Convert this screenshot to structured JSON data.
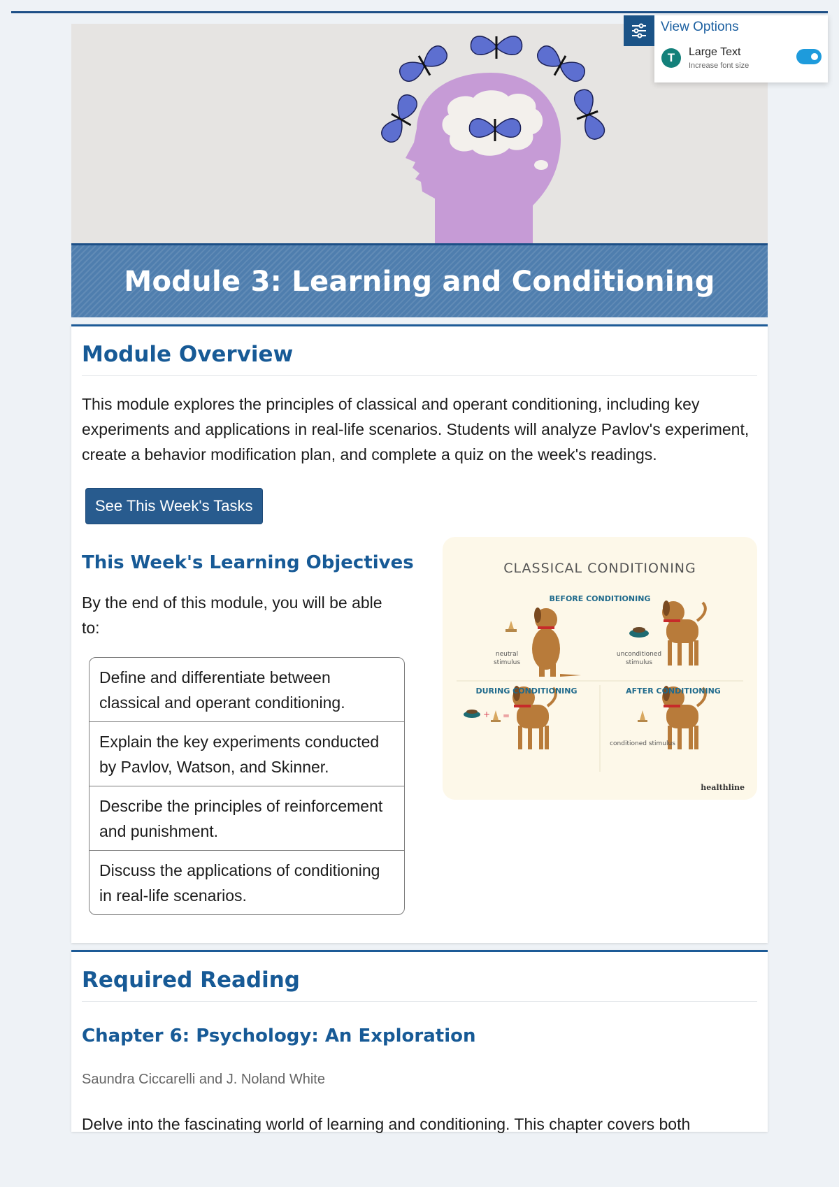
{
  "module": {
    "title": "Module 3: Learning and Conditioning"
  },
  "overview": {
    "heading": "Module Overview",
    "text": "This module explores the principles of classical and operant conditioning, including key experiments and applications in real-life scenarios. Students will analyze Pavlov's experiment, create a behavior modification plan, and complete a quiz on the week's readings.",
    "button_label": "See This Week's Tasks"
  },
  "objectives": {
    "heading": "This Week's Learning Objectives",
    "intro": "By the end of this module, you will be able to:",
    "items": [
      "Define and differentiate between classical and operant conditioning.",
      "Explain the key experiments conducted by Pavlov, Watson, and Skinner.",
      "Describe the principles of reinforcement and punishment.",
      "Discuss the applications of conditioning in real-life scenarios."
    ]
  },
  "diagram": {
    "title": "CLASSICAL CONDITIONING",
    "before": "BEFORE CONDITIONING",
    "during": "DURING CONDITIONING",
    "after": "AFTER CONDITIONING",
    "neutral_stimulus": "neutral stimulus",
    "unconditioned_stimulus": "unconditioned stimulus",
    "conditioned_stimulus": "conditioned stimulus",
    "brand": "healthline"
  },
  "reading": {
    "heading": "Required Reading",
    "chapter": "Chapter 6: Psychology: An Exploration",
    "authors": "Saundra Ciccarelli and J. Noland White",
    "text": "Delve into the fascinating world of learning and conditioning. This chapter covers both"
  },
  "view_options": {
    "title": "View Options",
    "avatar_letter": "T",
    "large_text_label": "Large Text",
    "large_text_sub": "Increase font size",
    "large_text_on": true
  },
  "colors": {
    "accent": "#175a96",
    "banner": "#4f7eae",
    "button": "#285b8e",
    "toggle": "#1e9bdc"
  }
}
